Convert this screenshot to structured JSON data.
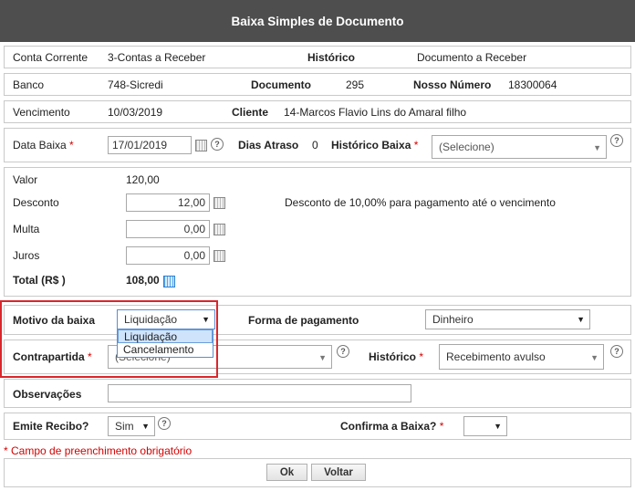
{
  "window": {
    "title": "Baixa Simples de Documento"
  },
  "conta": {
    "label": "Conta Corrente",
    "value": "3-Contas a Receber",
    "historico_label": "Histórico",
    "historico_value": "Documento a Receber"
  },
  "banco": {
    "label": "Banco",
    "value": "748-Sicredi",
    "documento_label": "Documento",
    "documento_value": "295",
    "nosso_label": "Nosso Número",
    "nosso_value": "18300064"
  },
  "vencimento": {
    "label": "Vencimento",
    "value": "10/03/2019",
    "cliente_label": "Cliente",
    "cliente_value": "14-Marcos Flavio Lins do Amaral filho"
  },
  "baixa": {
    "label": "Data Baixa",
    "required": "*",
    "value": "17/01/2019",
    "dias_label": "Dias Atraso",
    "dias_value": "0",
    "historico_label": "Histórico Baixa",
    "historico_select": "(Selecione)"
  },
  "valores": {
    "valor_label": "Valor",
    "valor": "120,00",
    "desconto_label": "Desconto",
    "desconto": "12,00",
    "desconto_note": "Desconto de 10,00% para pagamento até o vencimento",
    "multa_label": "Multa",
    "multa": "0,00",
    "juros_label": "Juros",
    "juros": "0,00",
    "total_label": "Total (R$ )",
    "total": "108,00"
  },
  "motivo": {
    "label": "Motivo da baixa",
    "selected": "Liquidação",
    "options": [
      "Liquidação",
      "Cancelamento"
    ],
    "forma_label": "Forma de pagamento",
    "forma_value": "Dinheiro"
  },
  "contrapartida": {
    "label": "Contrapartida",
    "required": "*",
    "select": "(Selecione)",
    "historico_label": "Histórico",
    "historico_value": "Recebimento avulso"
  },
  "observacoes": {
    "label": "Observações",
    "value": ""
  },
  "recibo": {
    "label": "Emite Recibo?",
    "value": "Sim",
    "confirma_label": "Confirma a Baixa?",
    "required": "*",
    "confirma_value": ""
  },
  "footer": {
    "note": "* Campo de preenchimento obrigatório",
    "ok": "Ok",
    "voltar": "Voltar"
  },
  "icons": {
    "help": "help-icon",
    "calendar": "calendar-icon",
    "calculator": "calculator-icon"
  },
  "colors": {
    "title_bar": "#4e4e4e",
    "required": "#d40000",
    "highlight": "#d9262b"
  }
}
